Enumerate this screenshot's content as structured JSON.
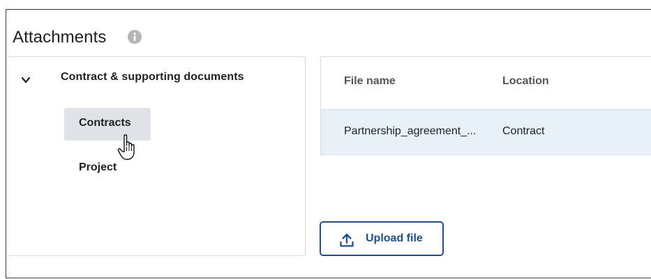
{
  "header": {
    "title": "Attachments"
  },
  "tree": {
    "group_label": "Contract & supporting documents",
    "folders": [
      "Contracts",
      "Project"
    ]
  },
  "table": {
    "columns": [
      "File name",
      "Location"
    ],
    "rows": [
      {
        "file_name": "Partnership_agreement_...",
        "location": "Contract"
      }
    ]
  },
  "actions": {
    "upload_label": "Upload file"
  },
  "colors": {
    "accent": "#1a4fa0",
    "selected_folder_bg": "#dfe2e6",
    "row_bg": "#e8f1f8",
    "info_icon": "#b5b5b5"
  }
}
